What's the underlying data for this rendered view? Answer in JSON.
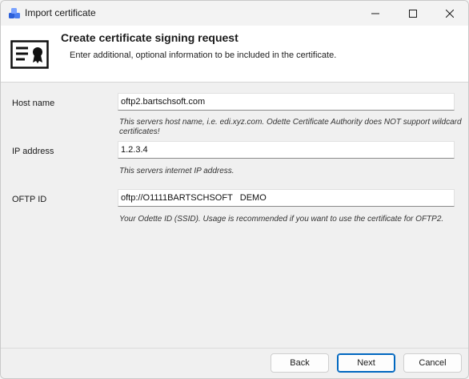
{
  "window": {
    "title": "Import certificate",
    "icon": "app-cubes-icon"
  },
  "header": {
    "title": "Create certificate signing request",
    "subtitle": "Enter additional, optional information to be included in the certificate.",
    "icon": "certificate-icon"
  },
  "form": {
    "fields": [
      {
        "label": "Host name",
        "value": "oftp2.bartschsoft.com",
        "hint": "This servers host name, i.e. edi.xyz.com. Odette Certificate Authority does NOT support wildcard certificates!"
      },
      {
        "label": "IP address",
        "value": "1.2.3.4",
        "hint": "This servers internet IP address."
      },
      {
        "label": "OFTP ID",
        "value": "oftp://O1111BARTSCHSOFT   DEMO",
        "hint": "Your Odette ID (SSID). Usage is recommended if you want to use the certificate for OFTP2."
      }
    ]
  },
  "footer": {
    "back_label": "Back",
    "next_label": "Next",
    "cancel_label": "Cancel"
  },
  "colors": {
    "accent": "#0067c0",
    "icon_blue": "#2b5fd9"
  }
}
